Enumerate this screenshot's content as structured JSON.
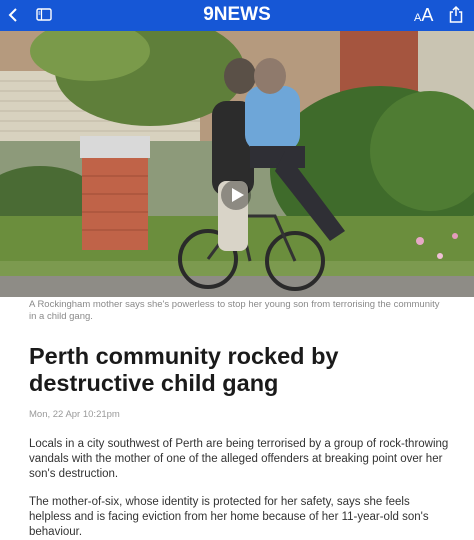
{
  "topbar": {
    "logo_prefix": "9",
    "logo_text": "NEWS",
    "text_size_small": "A",
    "text_size_big": "A",
    "background_color": "#1657d6",
    "icons": [
      "chevron-left-icon",
      "reader-view-icon",
      "text-size-icon",
      "share-icon"
    ]
  },
  "hero": {
    "has_play_button": true
  },
  "article": {
    "caption": "A Rockingham mother says she's powerless to stop her young son from terrorising the community in a child gang.",
    "headline": "Perth community rocked by destructive child gang",
    "date": "Mon, 22 Apr 10:21pm",
    "paragraphs": [
      "Locals in a city southwest of Perth are being terrorised by a group of rock-throwing vandals with the mother of one of the alleged offenders at breaking point over her son's destruction.",
      "The mother-of-six, whose identity is protected for her safety, says she feels helpless and is facing eviction from her home because of her 11-year-old son's behaviour."
    ]
  }
}
